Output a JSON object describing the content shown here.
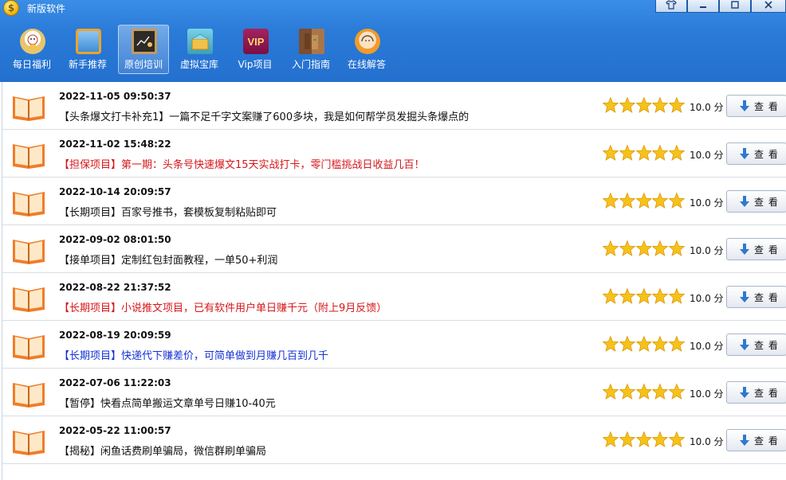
{
  "window": {
    "title": "新版软件",
    "buttons": [
      "shirt-icon",
      "minimize-icon",
      "restore-icon",
      "close-icon"
    ]
  },
  "toolbar": {
    "items": [
      {
        "label": "每日福利",
        "icon": "lucky-cat-icon"
      },
      {
        "label": "新手推荐",
        "icon": "monitor-icon"
      },
      {
        "label": "原创培训",
        "icon": "blackboard-icon",
        "active": true
      },
      {
        "label": "虚拟宝库",
        "icon": "treasure-box-icon"
      },
      {
        "label": "Vip项目",
        "icon": "vip-icon",
        "icon_text": "VIP"
      },
      {
        "label": "入门指南",
        "icon": "books-icon"
      },
      {
        "label": "在线解答",
        "icon": "support-agent-icon"
      }
    ]
  },
  "list": {
    "rating_max": 5,
    "button_label": "查 看",
    "items": [
      {
        "date": "2022-11-05 09:50:37",
        "title": "【头条爆文打卡补充1】一篇不足千字文案赚了600多块，我是如何帮学员发掘头条爆点的",
        "color": "#111111",
        "rating": 5,
        "score": "10.0 分"
      },
      {
        "date": "2022-11-02 15:48:22",
        "title": "【担保项目】第一期：头条号快速爆文15天实战打卡，零门槛挑战日收益几百！",
        "color": "#d6161a",
        "rating": 5,
        "score": "10.0 分"
      },
      {
        "date": "2022-10-14 20:09:57",
        "title": "【长期项目】百家号推书，套模板复制粘贴即可",
        "color": "#111111",
        "rating": 5,
        "score": "10.0 分"
      },
      {
        "date": "2022-09-02 08:01:50",
        "title": "【接单项目】定制红包封面教程，一单50+利润",
        "color": "#111111",
        "rating": 5,
        "score": "10.0 分"
      },
      {
        "date": "2022-08-22 21:37:52",
        "title": "【长期项目】小说推文项目，已有软件用户单日赚千元（附上9月反馈）",
        "color": "#d6161a",
        "rating": 5,
        "score": "10.0 分"
      },
      {
        "date": "2022-08-19 20:09:59",
        "title": "【长期项目】快递代下赚差价，可简单做到月赚几百到几千",
        "color": "#1430d6",
        "rating": 5,
        "score": "10.0 分"
      },
      {
        "date": "2022-07-06 11:22:03",
        "title": "【暂停】快看点简单搬运文章单号日赚10-40元",
        "color": "#111111",
        "rating": 5,
        "score": "10.0 分"
      },
      {
        "date": "2022-05-22 11:00:57",
        "title": "【揭秘】闲鱼话费刷单骗局，微信群刷单骗局",
        "color": "#111111",
        "rating": 5,
        "score": "10.0 分"
      }
    ]
  }
}
